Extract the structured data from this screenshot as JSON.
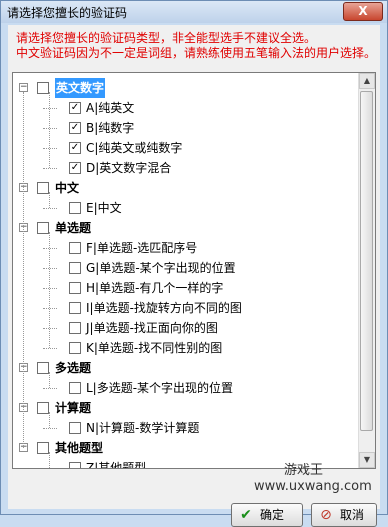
{
  "window": {
    "title": "请选择您擅长的验证码",
    "close_symbol": "X"
  },
  "notice": {
    "line1": "请选择您擅长的验证码类型，非全能型选手不建议全选。",
    "line2": "中文验证码因为不一定是词组，请熟练使用五笔输入法的用户选择。"
  },
  "tree": {
    "groups": [
      {
        "label": "英文数字",
        "selected": true,
        "items": [
          {
            "label": "A|纯英文",
            "checked": true
          },
          {
            "label": "B|纯数字",
            "checked": true
          },
          {
            "label": "C|纯英文或纯数字",
            "checked": true
          },
          {
            "label": "D|英文数字混合",
            "checked": true
          }
        ]
      },
      {
        "label": "中文",
        "items": [
          {
            "label": "E|中文",
            "checked": false
          }
        ]
      },
      {
        "label": "单选题",
        "items": [
          {
            "label": "F|单选题-选匹配序号",
            "checked": false
          },
          {
            "label": "G|单选题-某个字出现的位置",
            "checked": false
          },
          {
            "label": "H|单选题-有几个一样的字",
            "checked": false
          },
          {
            "label": "I|单选题-找旋转方向不同的图",
            "checked": false
          },
          {
            "label": "J|单选题-找正面向你的图",
            "checked": false
          },
          {
            "label": "K|单选题-找不同性别的图",
            "checked": false
          }
        ]
      },
      {
        "label": "多选题",
        "items": [
          {
            "label": "L|多选题-某个字出现的位置",
            "checked": false
          }
        ]
      },
      {
        "label": "计算题",
        "items": [
          {
            "label": "N|计算题-数学计算题",
            "checked": false
          }
        ]
      },
      {
        "label": "其他题型",
        "items": [
          {
            "label": "Z|其他题型",
            "checked": false
          }
        ]
      }
    ]
  },
  "watermark": {
    "line1": "游戏王",
    "line2": "www.uxwang.com"
  },
  "buttons": {
    "ok": "确定",
    "cancel": "取消"
  },
  "icons": {
    "ok": "check-icon",
    "cancel": "no-entry-icon",
    "collapse": "minus-icon",
    "check": "checkmark-icon"
  },
  "colors": {
    "notice": "#e00000",
    "selection": "#3399ff",
    "window_frame": "#c9dcf1"
  }
}
